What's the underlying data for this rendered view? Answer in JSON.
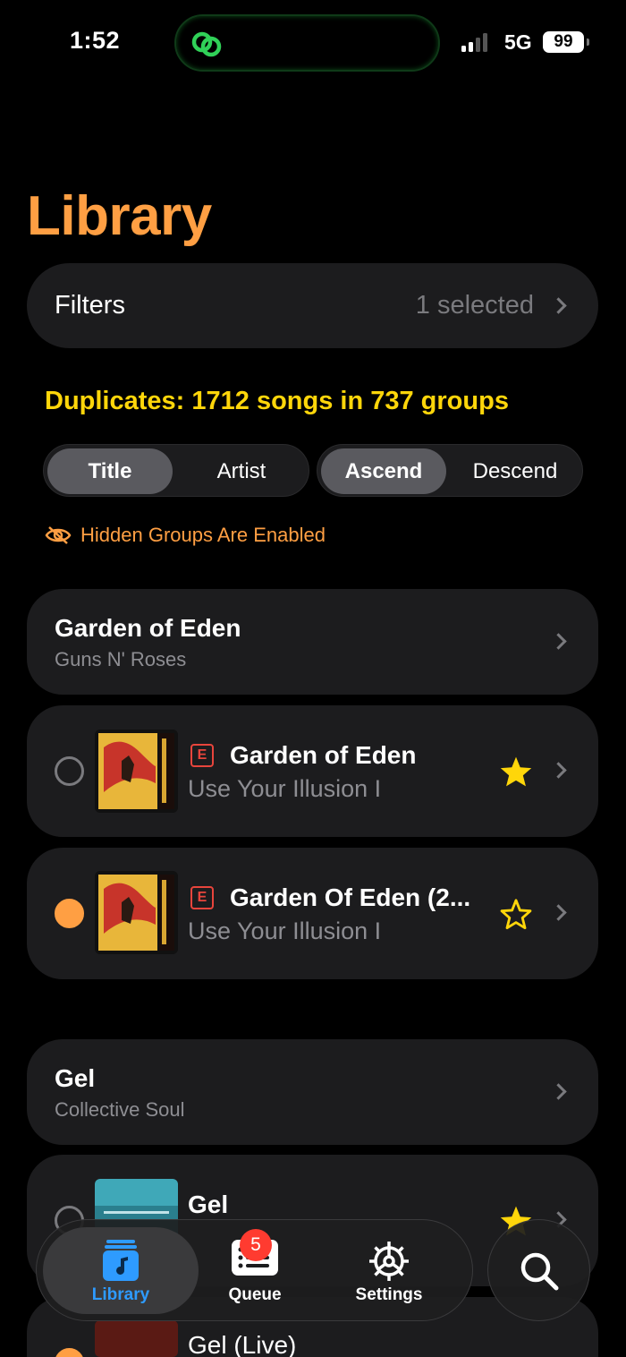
{
  "status": {
    "time": "1:52",
    "network": "5G",
    "battery": "99"
  },
  "page": {
    "title": "Library"
  },
  "filters": {
    "label": "Filters",
    "value": "1 selected"
  },
  "duplicates_summary": "Duplicates: 1712 songs in 737 groups",
  "sort_by": {
    "options": [
      "Title",
      "Artist"
    ],
    "selected": "Title"
  },
  "sort_order": {
    "options": [
      "Ascend",
      "Descend"
    ],
    "selected": "Ascend"
  },
  "hidden_groups_notice": "Hidden Groups Are Enabled",
  "groups": [
    {
      "title": "Garden of Eden",
      "artist": "Guns N' Roses",
      "songs": [
        {
          "title": "Garden of Eden",
          "album": "Use Your Illusion I",
          "explicit": "E",
          "selected": false,
          "starred": true
        },
        {
          "title": "Garden Of Eden (2...",
          "album": "Use Your Illusion I",
          "explicit": "E",
          "selected": true,
          "starred": false
        }
      ]
    },
    {
      "title": "Gel",
      "artist": "Collective Soul",
      "songs": [
        {
          "title": "Gel",
          "selected": false,
          "starred": true
        },
        {
          "title": "Gel (Live)",
          "selected": true
        }
      ]
    }
  ],
  "tabs": [
    {
      "label": "Library",
      "icon": "music-note-icon",
      "active": true
    },
    {
      "label": "Queue",
      "icon": "list-icon",
      "badge": "5"
    },
    {
      "label": "Settings",
      "icon": "gear-icon"
    }
  ],
  "colors": {
    "accent": "#ff9f43",
    "summary": "#ffd60a",
    "star": "#ffd60a",
    "explicit": "#e8453c",
    "badge": "#ff3b30",
    "tab_active": "#2e9bff"
  }
}
